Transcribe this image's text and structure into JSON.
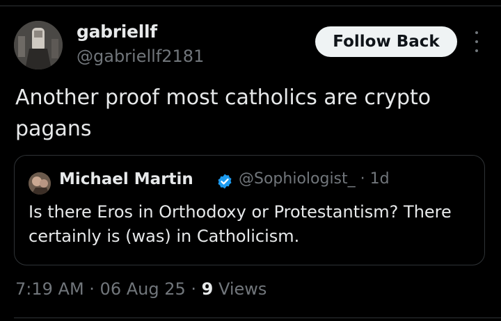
{
  "author": {
    "display_name": "gabriellf",
    "handle": "@gabriellf2181"
  },
  "follow_button_label": "Follow Back",
  "more_icon": "more-vertical-icon",
  "tweet_text": "Another proof most catholics are crypto pagans",
  "quote": {
    "display_name": "Michael Martin",
    "verified_icon": "verified-badge-icon",
    "verified_color": "#1d9bf0",
    "handle_time": "@Sophiologist_ · 1d",
    "text": "Is there Eros in Orthodoxy or Protestantism? There certainly is (was) in Catholicism."
  },
  "meta": {
    "time": "7:19 AM",
    "sep1": " · ",
    "date": "06 Aug 25",
    "sep2": " · ",
    "views_count": "9",
    "views_label": " Views"
  },
  "colors": {
    "background": "#000000",
    "primary_text": "#e7e9ea",
    "secondary_text": "#71767b",
    "button_bg": "#eff3f4",
    "border": "#2f3336"
  }
}
